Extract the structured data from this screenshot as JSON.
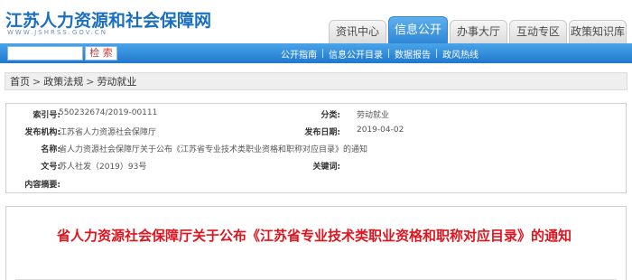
{
  "site": {
    "title": "江苏人力资源和社会保障网",
    "subtitle": "WWW.JSHRSS.GOV.CN"
  },
  "nav": {
    "tabs": [
      {
        "label": "资讯中心",
        "active": false
      },
      {
        "label": "信息公开",
        "active": true
      },
      {
        "label": "办事大厅",
        "active": false
      },
      {
        "label": "互动专区",
        "active": false
      },
      {
        "label": "政策知识库",
        "active": false
      }
    ]
  },
  "search": {
    "placeholder": "",
    "button_label": "检 索"
  },
  "sublinks": [
    "公开指南",
    "信息公开目录",
    "数据报告",
    "政风热线"
  ],
  "breadcrumb": [
    "首页",
    "政策法规",
    "劳动就业"
  ],
  "info": {
    "index_label": "索引号:",
    "index_value": "550232674/2019-00111",
    "category_label": "分类:",
    "category_value": "劳动就业",
    "publisher_label": "发布机构:",
    "publisher_value": "江苏省人力资源社会保障厅",
    "date_label": "发布日期:",
    "date_value": "2019-04-02",
    "name_label": "名称:",
    "name_value": "省人力资源社会保障厅关于公布《江苏省专业技术类职业资格和职称对应目录》的通知",
    "doc_no_label": "文号:",
    "doc_no_value": "苏人社发（2019）93号",
    "keywords_label": "关键词:",
    "keywords_value": "",
    "summary_label": "内容摘要:",
    "summary_value": ""
  },
  "article": {
    "title": "省人力资源社会保障厅关于公布《江苏省专业技术类职业资格和职称对应目录》的通知"
  },
  "colors": {
    "brand_blue": "#1a6fc0",
    "bar_blue": "#2f86d6",
    "title_red": "#e0141e"
  }
}
